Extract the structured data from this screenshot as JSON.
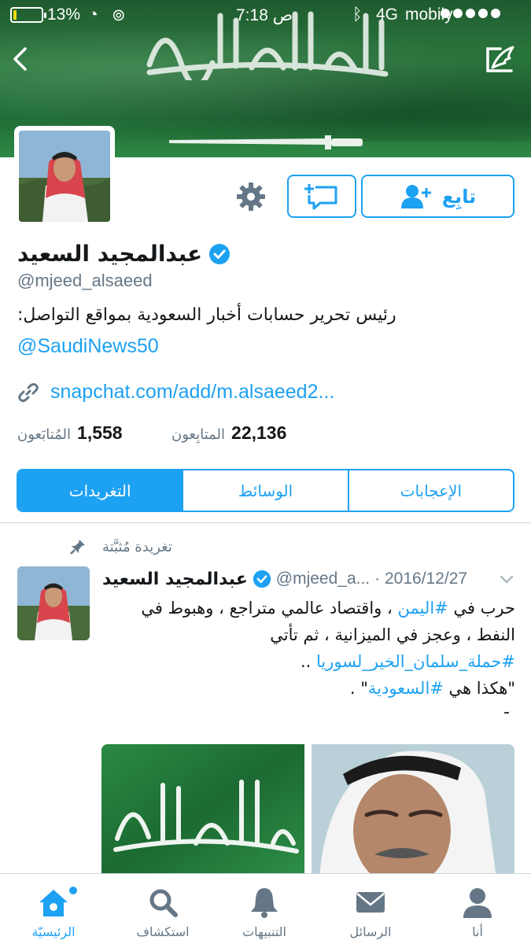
{
  "status_bar": {
    "battery": "13%",
    "time": "7:18 ص",
    "network": "4G",
    "carrier": "mobily",
    "battery_level": 0.13,
    "battery_color": "#f5d90a"
  },
  "header": {
    "back_icon": "chevron-left-icon",
    "edit_icon": "compose-icon"
  },
  "profile": {
    "name": "عبدالمجيد السعيد",
    "handle": "@mjeed_alsaeed",
    "bio": "رئيس تحرير حسابات أخبار السعودية بمواقع التواصل:",
    "bio_mention": "@SaudiNews50",
    "website": "snapchat.com/add/m.alsaeed2...",
    "follow_label": "تابِع",
    "followers_count": "22,136",
    "followers_label": "المتابِعون",
    "following_count": "1,558",
    "following_label": "المُتابَعون"
  },
  "tabs": [
    {
      "label": "الإعجابات"
    },
    {
      "label": "الوسائط"
    },
    {
      "label": "التغريدات"
    }
  ],
  "tweet": {
    "pinned_label": "تغريدة مُثبَّتة",
    "author_name": "عبدالمجيد السعيد",
    "author_handle": "@mjeed_a...",
    "date": "· 2016/12/27",
    "text_1": "حرب في ",
    "hashtag_1": "#اليمن",
    "text_2": " ، واقتصاد عالمي متراجع ، وهبوط في النفط ، وعجز في الميزانية ، ثم تأتي",
    "hashtag_2": "#حملة_سلمان_الخير_لسوريا",
    "text_3": " ..",
    "text_4": "\"هكذا هي ",
    "hashtag_3": "#السعودية",
    "text_5": "\" .",
    "dash": "-"
  },
  "bottom_nav": [
    {
      "label": "الرئيسيّة",
      "icon": "home-icon"
    },
    {
      "label": "استكشاف",
      "icon": "search-icon"
    },
    {
      "label": "التنبيهات",
      "icon": "bell-icon"
    },
    {
      "label": "الرسائل",
      "icon": "envelope-icon"
    },
    {
      "label": "أنا",
      "icon": "person-icon"
    }
  ],
  "colors": {
    "accent": "#1da1f2",
    "muted": "#657786",
    "banner_green": "#1e6b34"
  }
}
